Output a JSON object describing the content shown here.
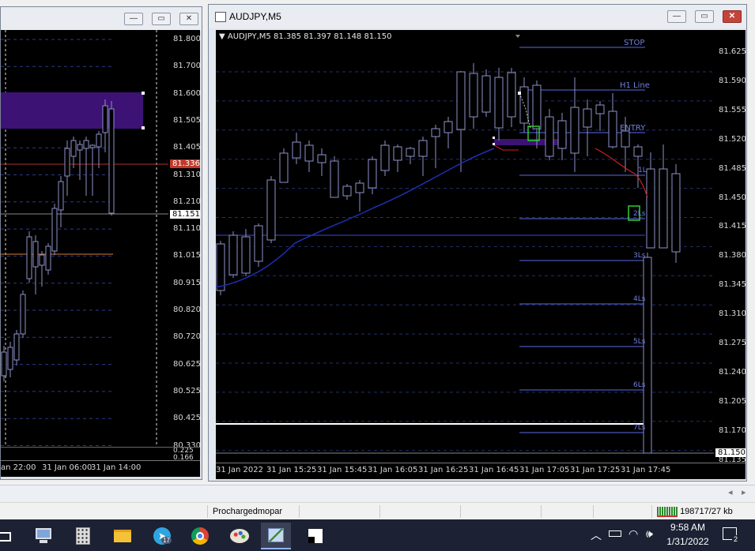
{
  "left_window": {
    "scale_labels": [
      "81.800",
      "81.700",
      "81.600",
      "81.505",
      "81.405",
      "81.310",
      "81.210",
      "81.110",
      "81.015",
      "80.915",
      "80.820",
      "80.720",
      "80.625",
      "80.525",
      "80.425",
      "80.330"
    ],
    "price_tag_red": "81.336",
    "price_tag_current": "81.151",
    "sub_scale": [
      "0.225",
      "0.166"
    ],
    "time_labels": [
      "an 22:00",
      "31 Jan 06:00",
      "31 Jan 14:00"
    ]
  },
  "right_window": {
    "title": "AUDJPY,M5",
    "info": "AUDJPY,M5  81.385 81.397 81.148 81.150",
    "scale_labels": [
      "81.625",
      "81.590",
      "81.555",
      "81.520",
      "81.485",
      "81.450",
      "81.415",
      "81.380",
      "81.345",
      "81.310",
      "81.275",
      "81.240",
      "81.205",
      "81.170",
      "81.135"
    ],
    "price_tag_current": "81.150",
    "time_labels": [
      "31 Jan 2022",
      "31 Jan 15:25",
      "31 Jan 15:45",
      "31 Jan 16:05",
      "31 Jan 16:25",
      "31 Jan 16:45",
      "31 Jan 17:05",
      "31 Jan 17:25",
      "31 Jan 17:45"
    ],
    "level_labels": {
      "stop": "STOP",
      "h1": "H1 Line",
      "entry": "ENTRY",
      "l1": "1L",
      "l2": "2Ls",
      "l3": "3Ls",
      "l4": "4Ls",
      "l5": "5Ls",
      "l6": "6Ls",
      "l7": "7Ls"
    },
    "colors": {
      "candle": "#8e92c9",
      "ma": "#1f2fb8",
      "levels": "#5a6ae8",
      "zone": "#3d1275"
    }
  },
  "tabs": {
    "left_arrow": "◂",
    "right_arrow": "▸"
  },
  "status": {
    "profile": "Prochargedmopar",
    "traffic": "198717/27 kb"
  },
  "taskbar": {
    "time": "9:58 AM",
    "date": "1/31/2022",
    "notifications": "2",
    "telegram_badge": "17"
  }
}
